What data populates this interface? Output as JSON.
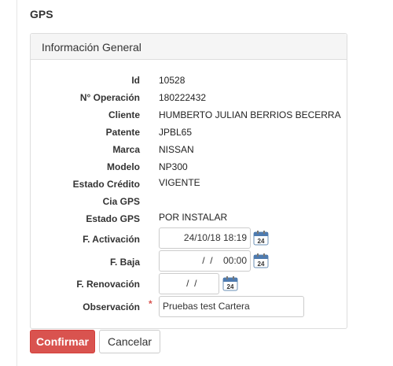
{
  "page": {
    "title": "GPS"
  },
  "panel": {
    "heading": "Información General",
    "fields": [
      {
        "label": "Id",
        "value": "10528"
      },
      {
        "label": "N° Operación",
        "value": "180222432"
      },
      {
        "label": "Cliente",
        "value": "HUMBERTO JULIAN BERRIOS BECERRA"
      },
      {
        "label": "Patente",
        "value": "JPBL65"
      },
      {
        "label": "Marca",
        "value": "NISSAN"
      },
      {
        "label": "Modelo",
        "value": "NP300"
      },
      {
        "label": "Estado Crédito",
        "value": "VIGENTE"
      },
      {
        "label": "Cia GPS",
        "value": ""
      },
      {
        "label": "Estado GPS",
        "value": "POR INSTALAR"
      }
    ],
    "activacion": {
      "label": "F. Activación",
      "value": "24/10/18 18:19"
    },
    "baja": {
      "label": "F. Baja",
      "value": "  /  /    00:00"
    },
    "renovacion": {
      "label": "F. Renovación",
      "value": "  /  /"
    },
    "observacion": {
      "label": "Observación",
      "required_mark": "*",
      "value": "Pruebas test Cartera"
    },
    "calendar_icon_text": "24"
  },
  "actions": {
    "confirm": "Confirmar",
    "cancel": "Cancelar"
  },
  "colors": {
    "danger": "#d9534f",
    "panel_heading_bg": "#f5f5f5",
    "border": "#dddddd"
  }
}
